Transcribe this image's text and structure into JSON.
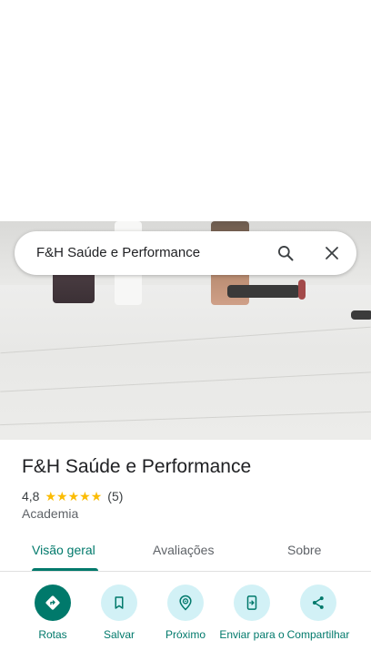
{
  "search": {
    "query": "F&H Saúde e Performance"
  },
  "place": {
    "name": "F&H Saúde e Performance",
    "rating": "4,8",
    "stars": 5,
    "review_count": "(5)",
    "category": "Academia"
  },
  "tabs": [
    {
      "label": "Visão geral",
      "active": true
    },
    {
      "label": "Avaliações",
      "active": false
    },
    {
      "label": "Sobre",
      "active": false
    }
  ],
  "actions": [
    {
      "label": "Rotas",
      "icon": "directions-icon"
    },
    {
      "label": "Salvar",
      "icon": "bookmark-icon"
    },
    {
      "label": "Próximo",
      "icon": "nearby-icon"
    },
    {
      "label": "Enviar para o",
      "icon": "send-to-phone-icon"
    },
    {
      "label": "Compartilhar",
      "icon": "share-icon"
    }
  ],
  "colors": {
    "accent": "#00796b",
    "action_bg": "#d2f1f6",
    "star": "#fbbc04"
  }
}
